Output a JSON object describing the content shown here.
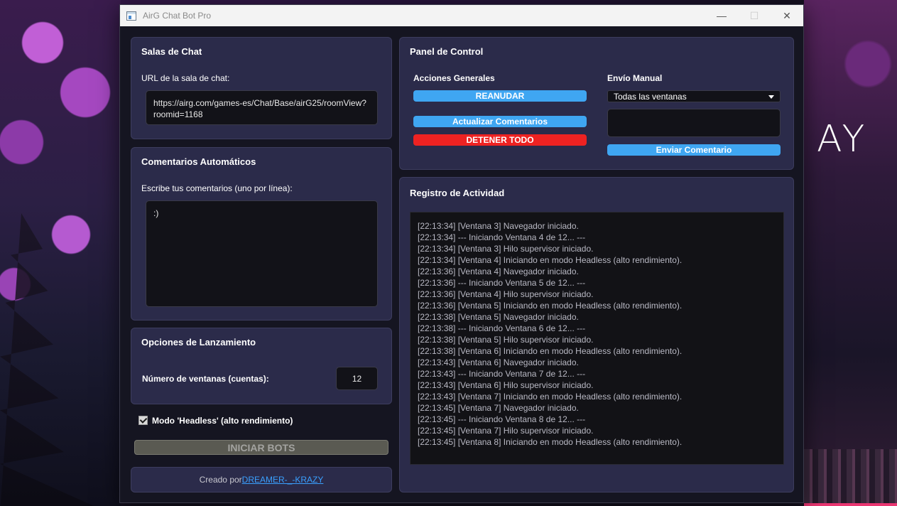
{
  "desktop": {
    "wallpaper_text": "AY"
  },
  "window": {
    "title": "AirG Chat Bot Pro",
    "controls": {
      "minimize": "—",
      "maximize": "☐",
      "close": "✕"
    }
  },
  "chat_rooms": {
    "title": "Salas de Chat",
    "url_label": "URL de la sala de chat:",
    "url_value": "https://airg.com/games-es/Chat/Base/airG25/roomView?roomid=1168"
  },
  "auto_comments": {
    "title": "Comentarios Automáticos",
    "label": "Escribe tus comentarios (uno por línea):",
    "value": ":)"
  },
  "launch_options": {
    "title": "Opciones de Lanzamiento",
    "windows_label": "Número de ventanas (cuentas):",
    "windows_value": "12"
  },
  "headless": {
    "label": "Modo 'Headless' (alto rendimiento)",
    "checked": true
  },
  "start_button": "INICIAR BOTS",
  "footer": {
    "prefix": "Creado por ",
    "link": "DREAMER-_-KRAZY"
  },
  "control_panel": {
    "title": "Panel de Control",
    "general_actions_label": "Acciones Generales",
    "resume_button": "REANUDAR",
    "refresh_button": "Actualizar Comentarios",
    "stop_button": "DETENER TODO",
    "manual_send_label": "Envío Manual",
    "target_select": "Todas las ventanas",
    "manual_input_value": "",
    "send_button": "Enviar Comentario"
  },
  "activity_log": {
    "title": "Registro de Actividad",
    "lines": [
      "[22:13:34] [Ventana 3] Navegador iniciado.",
      "[22:13:34] --- Iniciando Ventana 4 de 12... ---",
      "[22:13:34] [Ventana 3] Hilo supervisor iniciado.",
      "[22:13:34] [Ventana 4] Iniciando en modo Headless (alto rendimiento).",
      "[22:13:36] [Ventana 4] Navegador iniciado.",
      "[22:13:36] --- Iniciando Ventana 5 de 12... ---",
      "[22:13:36] [Ventana 4] Hilo supervisor iniciado.",
      "[22:13:36] [Ventana 5] Iniciando en modo Headless (alto rendimiento).",
      "[22:13:38] [Ventana 5] Navegador iniciado.",
      "[22:13:38] --- Iniciando Ventana 6 de 12... ---",
      "[22:13:38] [Ventana 5] Hilo supervisor iniciado.",
      "[22:13:38] [Ventana 6] Iniciando en modo Headless (alto rendimiento).",
      "[22:13:43] [Ventana 6] Navegador iniciado.",
      "[22:13:43] --- Iniciando Ventana 7 de 12... ---",
      "[22:13:43] [Ventana 6] Hilo supervisor iniciado.",
      "[22:13:43] [Ventana 7] Iniciando en modo Headless (alto rendimiento).",
      "[22:13:45] [Ventana 7] Navegador iniciado.",
      "[22:13:45] --- Iniciando Ventana 8 de 12... ---",
      "[22:13:45] [Ventana 7] Hilo supervisor iniciado.",
      "[22:13:45] [Ventana 8] Iniciando en modo Headless (alto rendimiento)."
    ]
  },
  "colors": {
    "accent_blue": "#3fa6f2",
    "danger_red": "#ee2222",
    "panel_bg": "#2b2b4a",
    "link": "#3aa0ff"
  }
}
